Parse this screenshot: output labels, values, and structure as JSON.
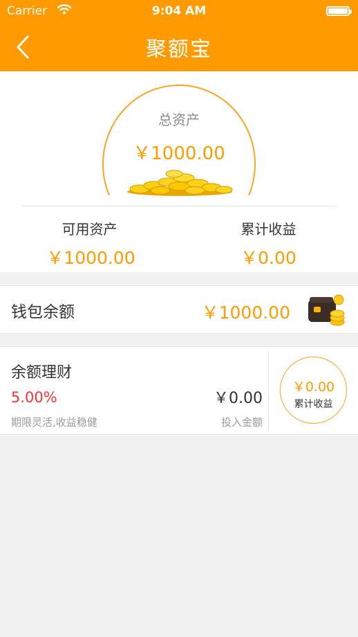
{
  "status_bar": {
    "carrier": "Carrier",
    "time": "9:04 AM"
  },
  "nav": {
    "title": "聚额宝"
  },
  "summary": {
    "total_label": "总资产",
    "total_value": "￥1000.00",
    "available_label": "可用资产",
    "available_value": "￥1000.00",
    "cumulative_label": "累计收益",
    "cumulative_value": "￥0.00"
  },
  "wallet": {
    "label": "钱包余额",
    "value": "￥1000.00"
  },
  "finance": {
    "title": "余额理财",
    "rate": "5.00%",
    "description": "期限灵活,收益稳健",
    "amount": "￥0.00",
    "amount_label": "投入金额",
    "earnings_value": "￥0.00",
    "earnings_label": "累计收益"
  },
  "colors": {
    "brand_orange": "#ff9b00",
    "rate_red": "#ff3030"
  },
  "icons": [
    "wifi-icon",
    "battery-icon",
    "back-chevron-icon",
    "gold-coins-icon",
    "wallet-icon"
  ]
}
